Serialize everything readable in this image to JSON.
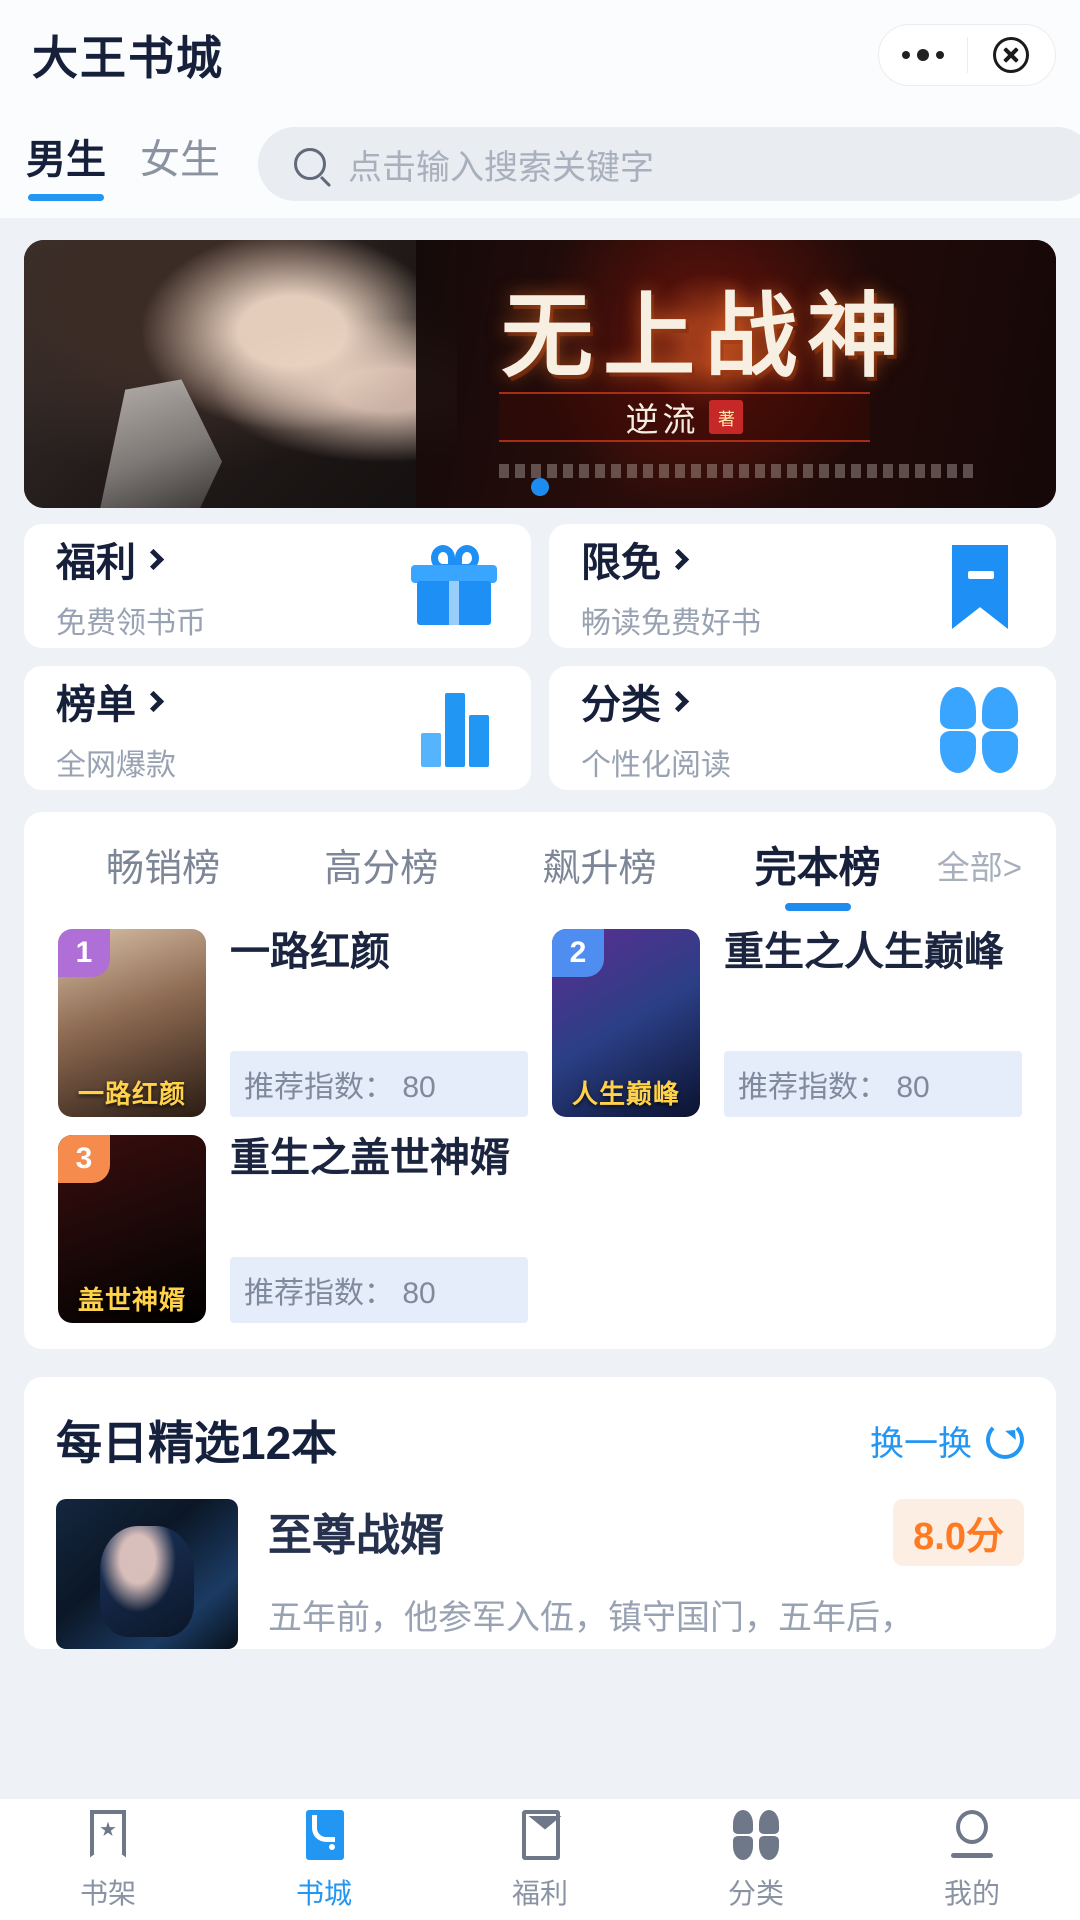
{
  "header": {
    "app_title": "大王书城",
    "more_icon": "more-dots-icon",
    "close_icon": "close-circle-icon"
  },
  "topbar": {
    "gender_tabs": [
      {
        "label": "男生",
        "active": true
      },
      {
        "label": "女生",
        "active": false
      }
    ],
    "search": {
      "placeholder": "点击输入搜索关键字",
      "icon": "search-icon"
    }
  },
  "banner": {
    "title": "无上战神",
    "author": "逆流",
    "seal": "著",
    "dots_count": 1,
    "active_dot": 0
  },
  "entries": [
    {
      "name": "福利",
      "desc": "免费领书币",
      "icon": "gift-icon"
    },
    {
      "name": "限免",
      "desc": "畅读免费好书",
      "icon": "bookmark-icon"
    },
    {
      "name": "榜单",
      "desc": "全网爆款",
      "icon": "bar-chart-icon"
    },
    {
      "name": "分类",
      "desc": "个性化阅读",
      "icon": "grid-petals-icon"
    }
  ],
  "ranking": {
    "tabs": [
      {
        "label": "畅销榜",
        "active": false
      },
      {
        "label": "高分榜",
        "active": false
      },
      {
        "label": "飙升榜",
        "active": false
      },
      {
        "label": "完本榜",
        "active": true
      }
    ],
    "all_label": "全部>",
    "score_prefix": "推荐指数：",
    "books": [
      {
        "rank": "1",
        "title": "一路红颜",
        "score": "推荐指数： 80",
        "cover_text": "一路红颜",
        "badge_color": "#b06fd6"
      },
      {
        "rank": "2",
        "title": "重生之人生巅峰",
        "score": "推荐指数： 80",
        "cover_text": "人生巅峰",
        "badge_color": "#4f8df0"
      },
      {
        "rank": "3",
        "title": "重生之盖世神婿",
        "score": "推荐指数： 80",
        "cover_text": "盖世神婿",
        "badge_color": "#f58b4c"
      }
    ]
  },
  "daily": {
    "title": "每日精选12本",
    "refresh_label": "换一换",
    "refresh_icon": "refresh-icon",
    "books": [
      {
        "title": "至尊战婿",
        "score": "8.0分",
        "desc": "五年前，他参军入伍，镇守国门，五年后，"
      }
    ]
  },
  "tabbar": [
    {
      "label": "书架",
      "icon": "bookshelf-icon",
      "active": false
    },
    {
      "label": "书城",
      "icon": "bookstore-icon",
      "active": true
    },
    {
      "label": "福利",
      "icon": "welfare-envelope-icon",
      "active": false
    },
    {
      "label": "分类",
      "icon": "category-icon",
      "active": false
    },
    {
      "label": "我的",
      "icon": "profile-icon",
      "active": false
    }
  ],
  "colors": {
    "accent": "#2196f3",
    "page_bg": "#eef1f6",
    "title_text": "#17203a",
    "muted_text": "#99a2b2",
    "score_orange": "#ff7a21"
  }
}
